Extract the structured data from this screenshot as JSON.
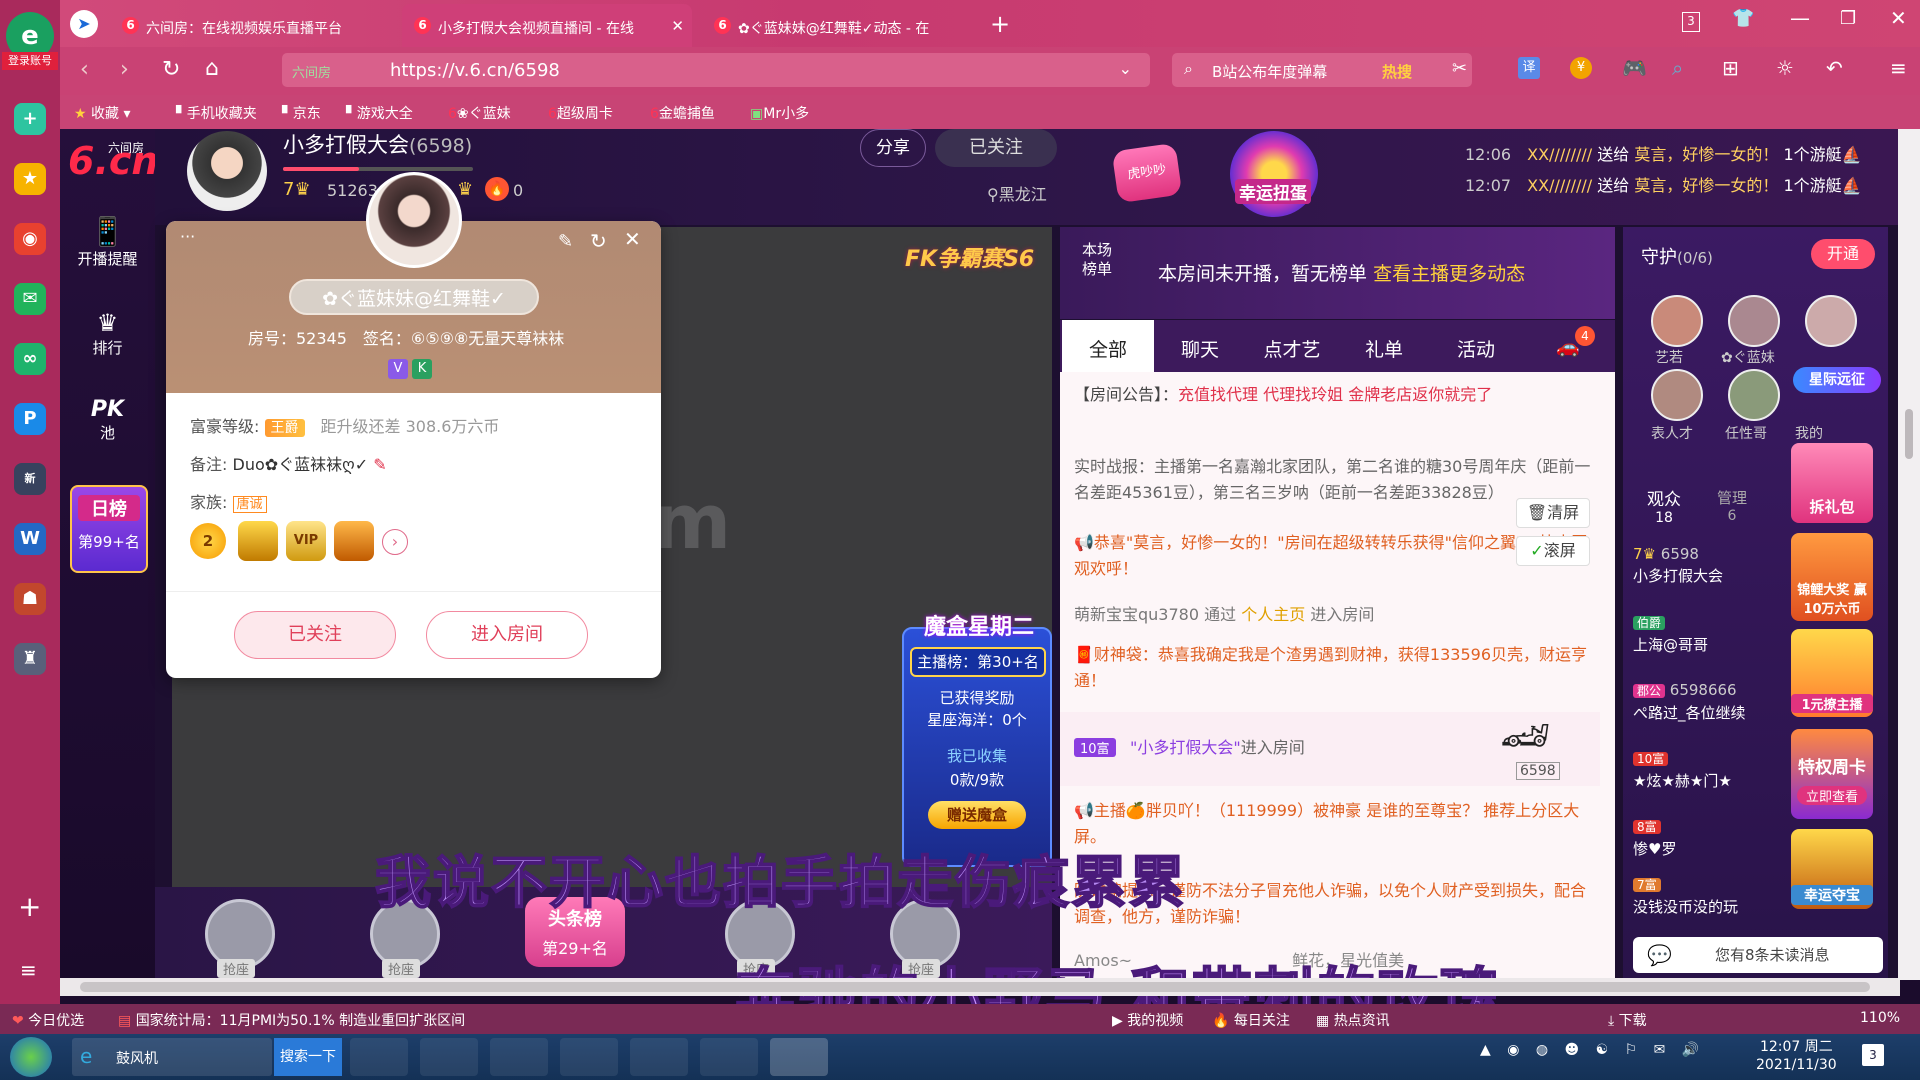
{
  "browser": {
    "login_label": "登录账号",
    "tabs": [
      {
        "title": "六间房：在线视频娱乐直播平台",
        "active": false
      },
      {
        "title": "小多打假大会视频直播间 - 在线",
        "active": true
      },
      {
        "title": "✿ぐ蓝妹妹@红舞鞋✓动态 - 在",
        "active": false
      }
    ],
    "tab_count": "3",
    "url_prefix": "六间房",
    "url": "https://v.6.cn/6598",
    "search_text": "B站公布年度弹幕",
    "search_hot": "热搜",
    "translate_label": "译",
    "bookmarks": [
      "收藏",
      "手机收藏夹",
      "京东",
      "游戏大全",
      "❀ぐ蓝妹",
      "超级周卡",
      "金蟾捕鱼",
      "Mr小多"
    ]
  },
  "left_nav": {
    "logo_small": "六间房",
    "logo_main": "6.cn",
    "items": [
      "开播提醒",
      "排行",
      "PK池"
    ],
    "daily_rank_title": "日榜",
    "daily_rank_value": "第99+名"
  },
  "header": {
    "streamer_name": "小多打假大会",
    "room_id": "(6598)",
    "fans_count": "51263",
    "heat": "0",
    "share_label": "分享",
    "follow_label": "已关注",
    "location": "黑龙江",
    "badge1": "虎吵吵",
    "badge2": "幸运扭蛋",
    "gift_msgs": [
      {
        "time": "12:06",
        "from": "XX////////",
        "verb": "送给",
        "to": "莫言，好惨一女的！",
        "count": "1个游艇"
      },
      {
        "time": "12:07",
        "from": "XX////////",
        "verb": "送给",
        "to": "莫言，好惨一女的！",
        "count": "1个游艇"
      }
    ]
  },
  "video": {
    "overlay_logo": "FK争霸赛S6",
    "magic_box": {
      "title": "魔盒星期二",
      "rank": "主播榜：第30+名",
      "reward_label": "已获得奖励",
      "reward": "星座海洋：0个",
      "collect_label": "我已收集",
      "collect_value": "0款/9款",
      "button": "赠送魔盒"
    },
    "seats": [
      "抢座",
      "抢座",
      "抢座",
      "抢座"
    ],
    "headline_title": "头条榜",
    "headline_value": "第29+名"
  },
  "rank_header": {
    "label": "本场榜单",
    "text": "本房间未开播，暂无榜单",
    "link": "查看主播更多动态"
  },
  "chat": {
    "tabs": [
      "全部",
      "聊天",
      "点才艺",
      "礼单",
      "活动"
    ],
    "car_badge": "4",
    "clear_btn": "清屏",
    "scroll_btn": "滚屏",
    "notice_label": "【房间公告】：",
    "notice_text": "充值找代理 代理找玲姐 金牌老店返你就完了",
    "battle": "实时战报：主播第一名嘉瀚北家团队，第二名谁的糖30号周年庆（距前一名差距45361豆），第三名三岁呐（距前一名差距33828豆）",
    "congrats": "恭喜\"莫言，好惨一女的！\"房间在超级转转乐获得\"信仰之翼\"，快来围观欢呼！",
    "enter_msg_user": "萌新宝宝qu3780",
    "enter_msg_mid": "通过",
    "enter_msg_link": "个人主页",
    "enter_msg_end": "进入房间",
    "wealth": "财神袋：恭喜我确定我是个渣男遇到财神，获得133596贝壳，财运亨通！",
    "vip_level": "10富",
    "vip_user": "\"小多打假大会\"",
    "vip_enter": "进入房间",
    "vip_car_id": "6598",
    "host_msg": "主播🍊胖贝吖！（1119999）被神豪 是谁的至尊宝？ 推荐上分区大屏。",
    "warning": "防诈骗提示：谨防不法分子冒充他人诈骗，以免个人财产受到损失，配合调查，他方，谨防诈骗！",
    "last_msg_user": "Amos~",
    "last_msg_text": "鲜花，星光值美"
  },
  "guard": {
    "title": "守护",
    "count": "(0/6)",
    "open_btn": "开通",
    "members": [
      "艺若",
      "✿ぐ蓝妹",
      "",
      "表人才",
      "任性哥",
      "我的"
    ],
    "tabs": [
      {
        "label": "观众",
        "value": "18"
      },
      {
        "label": "管理",
        "value": "6"
      }
    ],
    "viewers": [
      {
        "level": "",
        "id": "6598",
        "name": "小多打假大会"
      },
      {
        "level": "伯爵",
        "id": "",
        "name": "上海@哥哥"
      },
      {
        "level": "郡公",
        "id": "6598666",
        "name": "ぺ路过_各位继续"
      },
      {
        "level": "10富",
        "id": "",
        "name": "★炫★赫★门★"
      },
      {
        "level": "8富",
        "id": "",
        "name": "惨♥罗"
      },
      {
        "level": "7富",
        "id": "",
        "name": "没钱没币没的玩"
      }
    ],
    "promos": [
      "星际远征",
      "拆礼包",
      "锦鲤大奖 赢10万六币",
      "1元撩主播",
      "特权周卡",
      "立即查看",
      "幸运夺宝"
    ],
    "unread": "您有8条未读消息"
  },
  "card": {
    "nickname": "✿ぐ蓝妹妹@红舞鞋✓",
    "room_label": "房号：52345",
    "sign_label": "签名：⑥⑤⑨⑧无量天尊袜袜",
    "wealth_label": "富豪等级:",
    "wealth_badge": "王爵",
    "wealth_gap": "距升级还差 308.6万六币",
    "note_label": "备注:",
    "note_value": "Duo✿ぐ蓝袜袜ღ✓",
    "family_label": "家族:",
    "family_value": "唐诚",
    "followed_btn": "已关注",
    "enter_btn": "进入房间"
  },
  "lyrics": {
    "line1": "我说不开心也拍手拍走伤痕累累",
    "line2": "奔驰的小野马 和带刺的玫瑰"
  },
  "bottom_bar": {
    "left1": "今日优选",
    "left2": "国家统计局：11月PMI为50.1% 制造业重回扩张区间",
    "right": [
      "我的视频",
      "每日关注",
      "热点资讯",
      "下载"
    ],
    "zoom": "110%"
  },
  "taskbar": {
    "app_label": "鼓风机",
    "search_btn": "搜索一下",
    "time": "12:07 周二",
    "date": "2021/11/30",
    "notif": "3"
  }
}
